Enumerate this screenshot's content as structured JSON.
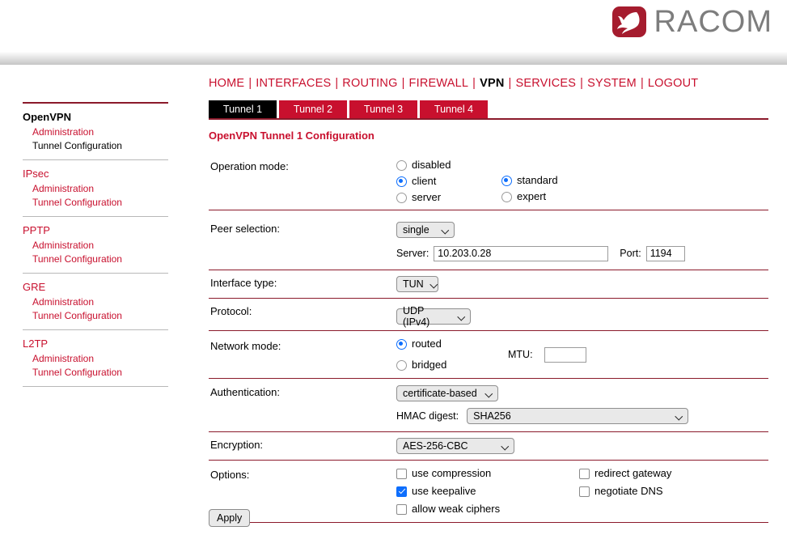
{
  "brand": {
    "name": "RACOM",
    "logo_color": "#a51c2e",
    "text_color": "#7d7d7d"
  },
  "topnav": {
    "items": [
      {
        "label": "HOME",
        "active": false
      },
      {
        "label": "INTERFACES",
        "active": false
      },
      {
        "label": "ROUTING",
        "active": false
      },
      {
        "label": "FIREWALL",
        "active": false
      },
      {
        "label": "VPN",
        "active": true
      },
      {
        "label": "SERVICES",
        "active": false
      },
      {
        "label": "SYSTEM",
        "active": false
      },
      {
        "label": "LOGOUT",
        "active": false
      }
    ],
    "separator": "|",
    "link_color": "#c8102e"
  },
  "tabs": [
    {
      "label": "Tunnel 1",
      "active": true
    },
    {
      "label": "Tunnel 2",
      "active": false
    },
    {
      "label": "Tunnel 3",
      "active": false
    },
    {
      "label": "Tunnel 4",
      "active": false
    }
  ],
  "sidebar": {
    "groups": [
      {
        "title": "OpenVPN",
        "current": true,
        "links": [
          {
            "label": "Administration",
            "current": false
          },
          {
            "label": "Tunnel Configuration",
            "current": true
          }
        ]
      },
      {
        "title": "IPsec",
        "current": false,
        "links": [
          {
            "label": "Administration",
            "current": false
          },
          {
            "label": "Tunnel Configuration",
            "current": false
          }
        ]
      },
      {
        "title": "PPTP",
        "current": false,
        "links": [
          {
            "label": "Administration",
            "current": false
          },
          {
            "label": "Tunnel Configuration",
            "current": false
          }
        ]
      },
      {
        "title": "GRE",
        "current": false,
        "links": [
          {
            "label": "Administration",
            "current": false
          },
          {
            "label": "Tunnel Configuration",
            "current": false
          }
        ]
      },
      {
        "title": "L2TP",
        "current": false,
        "links": [
          {
            "label": "Administration",
            "current": false
          },
          {
            "label": "Tunnel Configuration",
            "current": false
          }
        ]
      }
    ]
  },
  "form": {
    "title": "OpenVPN Tunnel 1 Configuration",
    "operation_mode": {
      "label": "Operation mode:",
      "mode_options": [
        "disabled",
        "client",
        "server"
      ],
      "mode_selected": "client",
      "level_options": [
        "standard",
        "expert"
      ],
      "level_selected": "standard"
    },
    "peer_selection": {
      "label": "Peer selection:",
      "value": "single",
      "server_label": "Server:",
      "server_value": "10.203.0.28",
      "port_label": "Port:",
      "port_value": "1194"
    },
    "interface_type": {
      "label": "Interface type:",
      "value": "TUN"
    },
    "protocol": {
      "label": "Protocol:",
      "value": "UDP (IPv4)"
    },
    "network_mode": {
      "label": "Network mode:",
      "options": [
        "routed",
        "bridged"
      ],
      "selected": "routed",
      "mtu_label": "MTU:",
      "mtu_value": ""
    },
    "authentication": {
      "label": "Authentication:",
      "value": "certificate-based",
      "hmac_label": "HMAC digest:",
      "hmac_value": "SHA256"
    },
    "encryption": {
      "label": "Encryption:",
      "value": "AES-256-CBC"
    },
    "options": {
      "label": "Options:",
      "left": [
        {
          "label": "use compression",
          "checked": false
        },
        {
          "label": "use keepalive",
          "checked": true
        },
        {
          "label": "allow weak ciphers",
          "checked": false
        }
      ],
      "right": [
        {
          "label": "redirect gateway",
          "checked": false
        },
        {
          "label": "negotiate DNS",
          "checked": false
        }
      ]
    },
    "apply_label": "Apply"
  },
  "colors": {
    "accent_red": "#c8102e",
    "rule_red": "#8b1a2b",
    "radio_blue": "#0d6efd"
  }
}
